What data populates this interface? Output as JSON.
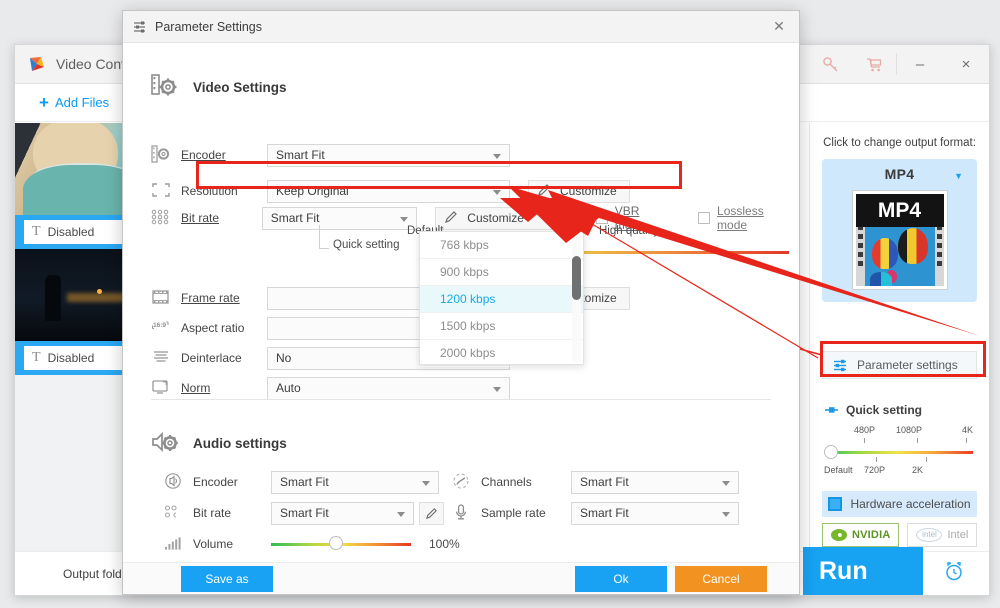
{
  "app": {
    "title": "Video Converter",
    "logo_icon": "video-converter-logo",
    "toolbar": {
      "add_files_label": "Add Files",
      "plus_icon": "plus-icon"
    },
    "titlebar_icons": [
      {
        "name": "key-icon",
        "glyph": "⚷"
      },
      {
        "name": "cart-icon",
        "glyph": "Ὥ2"
      }
    ],
    "window_controls": {
      "minimize": "–",
      "close": "×"
    },
    "file_list": [
      {
        "subtitle_label": "Disabled",
        "subtitle_icon": "text-subtitle-icon",
        "thumb": "thumb-person-teal-hoodie"
      },
      {
        "subtitle_label": "Disabled",
        "subtitle_icon": "text-subtitle-icon",
        "thumb": "thumb-night-street"
      }
    ],
    "bottom": {
      "output_folder_label": "Output folder:",
      "output_folder_value": "",
      "run_label": "Run",
      "alarm_icon": "alarm-clock-icon"
    }
  },
  "sidebar": {
    "prompt": "Click to change output format:",
    "format": {
      "name": "MP4",
      "thumb_badge": "MP4",
      "caret_icon": "chevron-down-icon"
    },
    "parameter_settings_label": "Parameter settings",
    "parameter_settings_icon": "sliders-icon",
    "quick_setting": {
      "label": "Quick setting",
      "icon": "quick-setting-icon",
      "top_labels": [
        "480P",
        "1080P",
        "4K"
      ],
      "bottom_labels": [
        "Default",
        "720P",
        "2K"
      ],
      "knob_position_percent": 0
    },
    "hardware_acceleration": {
      "label": "Hardware acceleration",
      "icon": "chip-icon",
      "chips": [
        {
          "name": "NVIDIA",
          "enabled": true
        },
        {
          "name": "Intel",
          "enabled": false
        }
      ]
    }
  },
  "dialog": {
    "title": "Parameter Settings",
    "title_icon": "sliders-icon",
    "close_icon": "close-icon",
    "video_section": {
      "title": "Video Settings",
      "icon": "film-gear-icon",
      "rows": [
        {
          "label": "Encoder",
          "icon": "encoder-icon",
          "value": "Smart Fit",
          "underlined": true,
          "customize": null,
          "caret_icon": "chevron-down-icon"
        },
        {
          "label": "Resolution",
          "icon": "resolution-icon",
          "value": "Keep Original",
          "underlined": false,
          "customize": "Customize",
          "caret_icon": "chevron-down-icon"
        },
        {
          "label": "Bit rate",
          "icon": "bitrate-icon",
          "value": "Smart Fit",
          "underlined": true,
          "customize": "Customize",
          "caret_icon": "chevron-down-icon"
        },
        {
          "label": "Frame rate",
          "icon": "framerate-icon",
          "value": "",
          "underlined": true,
          "customize": "Customize",
          "caret_icon": "chevron-down-icon"
        },
        {
          "label": "Aspect ratio",
          "icon": "aspect-ratio-icon",
          "value": "",
          "underlined": false,
          "customize": null,
          "caret_icon": "chevron-down-icon"
        },
        {
          "label": "Deinterlace",
          "icon": "deinterlace-icon",
          "value": "No",
          "underlined": false,
          "customize": null,
          "caret_icon": "chevron-down-icon"
        },
        {
          "label": "Norm",
          "icon": "norm-icon",
          "value": "Auto",
          "underlined": true,
          "customize": null,
          "caret_icon": "chevron-down-icon"
        }
      ],
      "vbr_mode": {
        "label": "VBR mode",
        "checked": false
      },
      "lossless_mode": {
        "label": "Lossless mode",
        "checked": false
      },
      "quick_setting": {
        "label": "Quick setting",
        "left_label": "Default",
        "right_label": "High quality",
        "knob_position_percent": 0
      }
    },
    "bitrate_dropdown": {
      "open": true,
      "selected": "1200 kbps",
      "options": [
        "768 kbps",
        "900 kbps",
        "1200 kbps",
        "1500 kbps",
        "2000 kbps"
      ],
      "scrollbar": true
    },
    "audio_section": {
      "title": "Audio settings",
      "icon": "speaker-gear-icon",
      "left_rows": [
        {
          "label": "Encoder",
          "icon": "audio-encoder-icon",
          "value": "Smart Fit",
          "pencil": false,
          "caret_icon": "chevron-down-icon"
        },
        {
          "label": "Bit rate",
          "icon": "audio-bitrate-icon",
          "value": "Smart Fit",
          "pencil": true,
          "caret_icon": "chevron-down-icon"
        }
      ],
      "right_rows": [
        {
          "label": "Channels",
          "icon": "channels-icon",
          "value": "Smart Fit",
          "caret_icon": "chevron-down-icon"
        },
        {
          "label": "Sample rate",
          "icon": "microphone-icon",
          "value": "Smart Fit",
          "caret_icon": "chevron-down-icon"
        }
      ],
      "volume": {
        "label": "Volume",
        "icon": "volume-bars-icon",
        "value": "100%",
        "knob_position_percent": 42
      }
    },
    "footer": {
      "save_as_label": "Save as",
      "ok_label": "Ok",
      "cancel_label": "Cancel"
    }
  },
  "annotations": {
    "highlight_color": "#e8251b",
    "boxes": [
      "bit-rate-row",
      "parameter-settings-button"
    ],
    "arrow": "red-arrow-from-parameter-settings-to-bit-rate-row"
  }
}
